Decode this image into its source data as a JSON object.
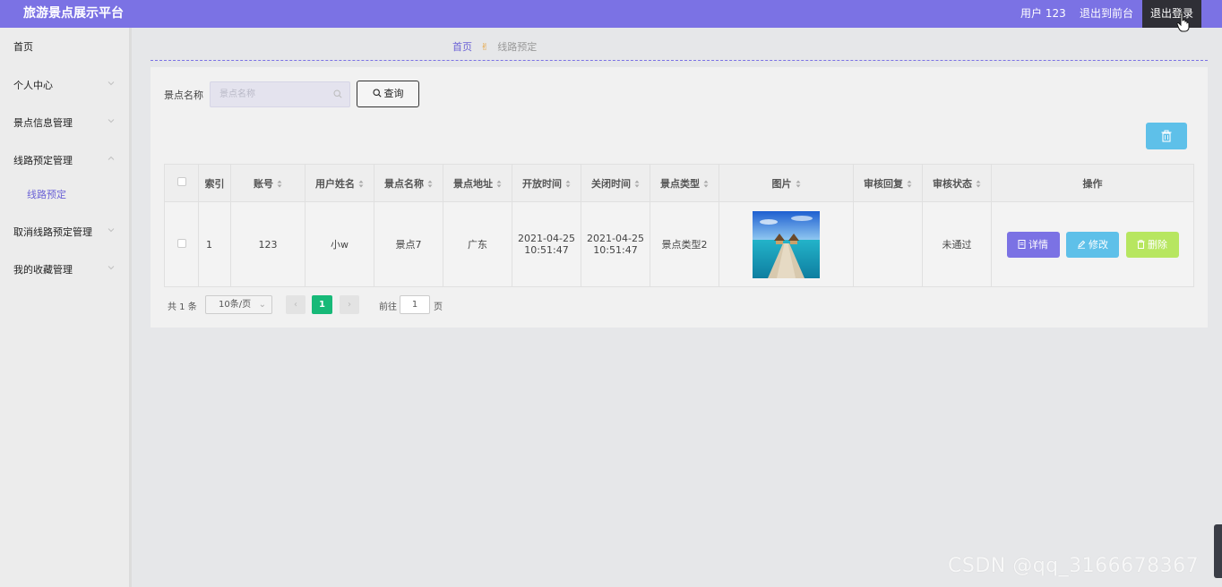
{
  "header": {
    "brand": "旅游景点展示平台",
    "user": "用户 123",
    "front": "退出到前台",
    "logout": "退出登录"
  },
  "sidebar": {
    "items": [
      {
        "label": "首页"
      },
      {
        "label": "个人中心"
      },
      {
        "label": "景点信息管理"
      },
      {
        "label": "线路预定管理"
      },
      {
        "label": "取消线路预定管理"
      },
      {
        "label": "我的收藏管理"
      }
    ],
    "sub_item": "线路预定"
  },
  "breadcrumb": {
    "home": "首页",
    "current": "线路预定"
  },
  "search": {
    "label": "景点名称",
    "placeholder": "景点名称",
    "button": "查询"
  },
  "table": {
    "headers": [
      "索引",
      "账号",
      "用户姓名",
      "景点名称",
      "景点地址",
      "开放时间",
      "关闭时间",
      "景点类型",
      "图片",
      "审核回复",
      "审核状态",
      "操作"
    ],
    "rows": [
      {
        "index": "1",
        "account": "123",
        "user_name": "小w",
        "spot_name": "景点7",
        "address": "广东",
        "open_date": "2021-04-25",
        "open_time": "10:51:47",
        "close_date": "2021-04-25",
        "close_time": "10:51:47",
        "spot_type": "景点类型2",
        "reply": "",
        "status": "未通过"
      }
    ],
    "actions": {
      "detail": "详情",
      "edit": "修改",
      "delete": "删除"
    }
  },
  "pagination": {
    "total": "共 1 条",
    "page_size": "10条/页",
    "current_page": "1",
    "goto_prefix": "前往",
    "goto_value": "1",
    "goto_suffix": "页"
  },
  "watermark": "CSDN @qq_3166678367",
  "colors": {
    "primary": "#7b72e4",
    "info": "#5ec0e9",
    "success": "#b7e660",
    "page_active": "#17b978"
  }
}
